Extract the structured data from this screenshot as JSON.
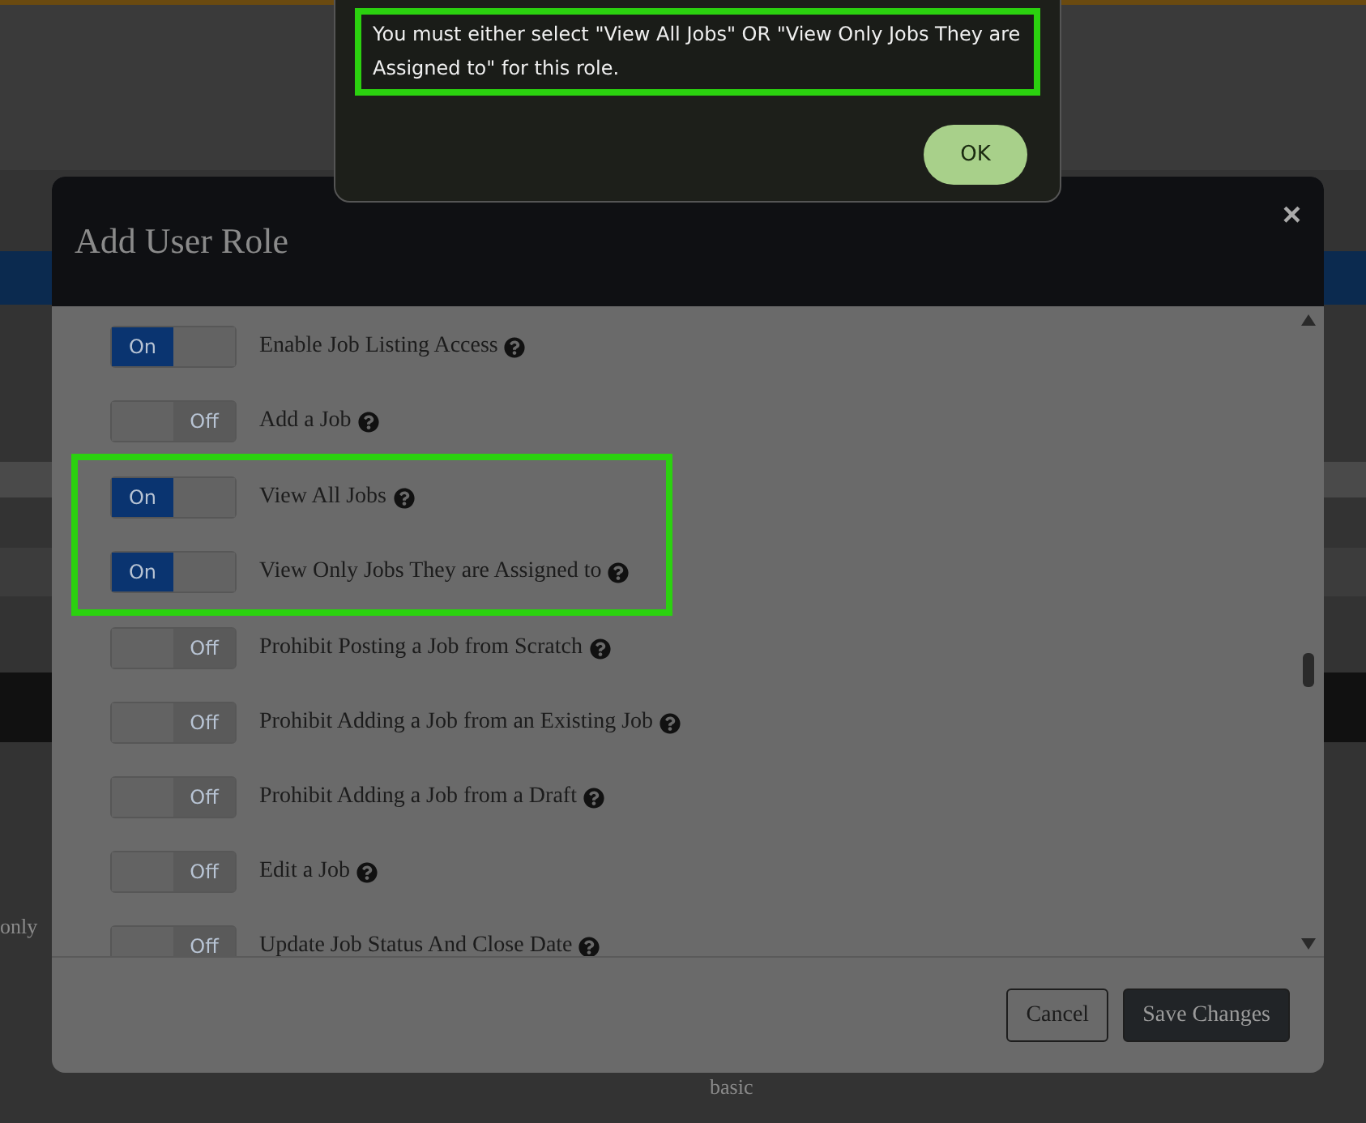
{
  "alert": {
    "message": "You must either select \"View All Jobs\" OR \"View Only Jobs They are Assigned to\" for this role.",
    "highlighted": true,
    "button": "OK"
  },
  "background": {
    "fragments": [
      "only",
      "basic"
    ]
  },
  "modal": {
    "title": "Add User Role",
    "close": "×",
    "permissions": [
      {
        "label": "Enable Job Listing Access",
        "on": true,
        "toggle_text": "On",
        "highlighted": false
      },
      {
        "label": "Add a Job",
        "on": false,
        "toggle_text": "Off",
        "highlighted": false
      },
      {
        "label": "View All Jobs",
        "on": true,
        "toggle_text": "On",
        "highlighted": true
      },
      {
        "label": "View Only Jobs They are Assigned to",
        "on": true,
        "toggle_text": "On",
        "highlighted": true
      },
      {
        "label": "Prohibit Posting a Job from Scratch",
        "on": false,
        "toggle_text": "Off",
        "highlighted": false
      },
      {
        "label": "Prohibit Adding a Job from an Existing Job",
        "on": false,
        "toggle_text": "Off",
        "highlighted": false
      },
      {
        "label": "Prohibit Adding a Job from a Draft",
        "on": false,
        "toggle_text": "Off",
        "highlighted": false
      },
      {
        "label": "Edit a Job",
        "on": false,
        "toggle_text": "Off",
        "highlighted": false
      },
      {
        "label": "Update Job Status And Close Date",
        "on": false,
        "toggle_text": "Off",
        "highlighted": false
      }
    ],
    "buttons": [
      {
        "label": "Cancel",
        "kind": "secondary"
      },
      {
        "label": "Save Changes",
        "kind": "primary"
      }
    ]
  }
}
